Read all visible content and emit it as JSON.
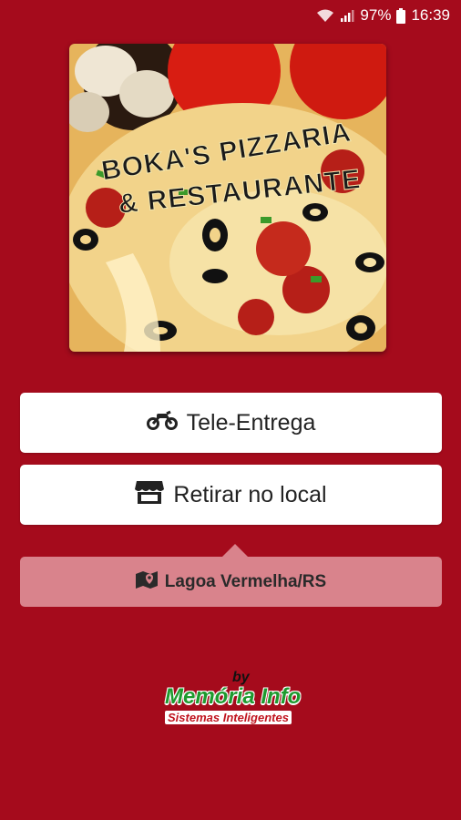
{
  "status_bar": {
    "battery": "97%",
    "time": "16:39"
  },
  "logo": {
    "line1": "BOKA'S PIZZARIA",
    "line2": "& RESTAURANTE"
  },
  "actions": {
    "delivery_label": "Tele-Entrega",
    "pickup_label": "Retirar no local"
  },
  "location": {
    "label": "Lagoa Vermelha/RS"
  },
  "brand": {
    "by": "by",
    "name": "Memória Info",
    "tagline": "Sistemas Inteligentes"
  },
  "icons": {
    "wifi": "wifi-icon",
    "signal": "signal-icon",
    "battery": "battery-icon",
    "motorcycle": "motorcycle-icon",
    "store": "store-icon",
    "map": "map-marker-icon"
  },
  "colors": {
    "background": "#a50b1c",
    "button": "#ffffff",
    "location_bg": "#d9838c",
    "brand_green": "#1e9a2e",
    "brand_red": "#c0141f"
  }
}
